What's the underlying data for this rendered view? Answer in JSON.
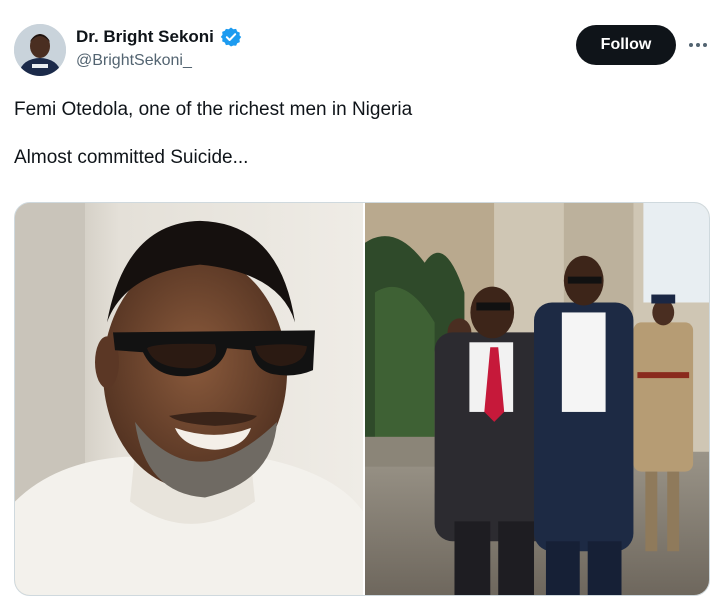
{
  "author": {
    "display_name": "Dr. Bright Sekoni",
    "handle": "@BrightSekoni_",
    "verified_icon": "verified-badge-icon"
  },
  "actions": {
    "follow_label": "Follow",
    "more_icon": "more-options-icon"
  },
  "tweet": {
    "line1": "Femi Otedola, one of the richest men in Nigeria",
    "line2": "Almost committed Suicide..."
  },
  "media": {
    "count": 2
  },
  "colors": {
    "text": "#0f1419",
    "secondary": "#536471",
    "verified": "#1d9bf0",
    "follow_bg": "#0f1419",
    "border": "#cfd9de"
  }
}
